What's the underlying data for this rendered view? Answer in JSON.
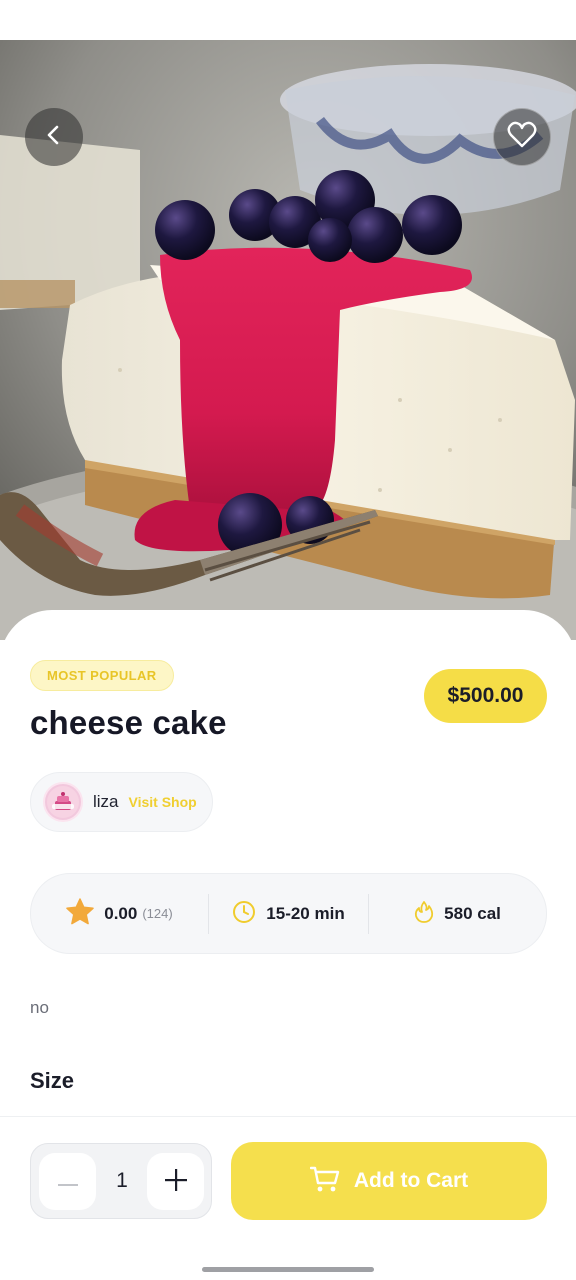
{
  "product": {
    "badge": "MOST POPULAR",
    "title": "cheese cake",
    "price": "$500.00",
    "description": "no"
  },
  "shop": {
    "name": "liza",
    "visit_label": "Visit Shop",
    "avatar_icon": "cake-shop-logo"
  },
  "stats": {
    "rating": "0.00",
    "rating_count": "(124)",
    "time": "15-20 min",
    "calories": "580 cal",
    "icons": [
      "star-icon",
      "clock-icon",
      "flame-icon"
    ]
  },
  "sections": {
    "size_heading": "Size"
  },
  "cart": {
    "quantity": "1",
    "add_label": "Add to Cart"
  },
  "colors": {
    "accent": "#f5df4d",
    "badge_bg": "#fdf6c6",
    "badge_text": "#e8c528",
    "star": "#f2a93b"
  }
}
